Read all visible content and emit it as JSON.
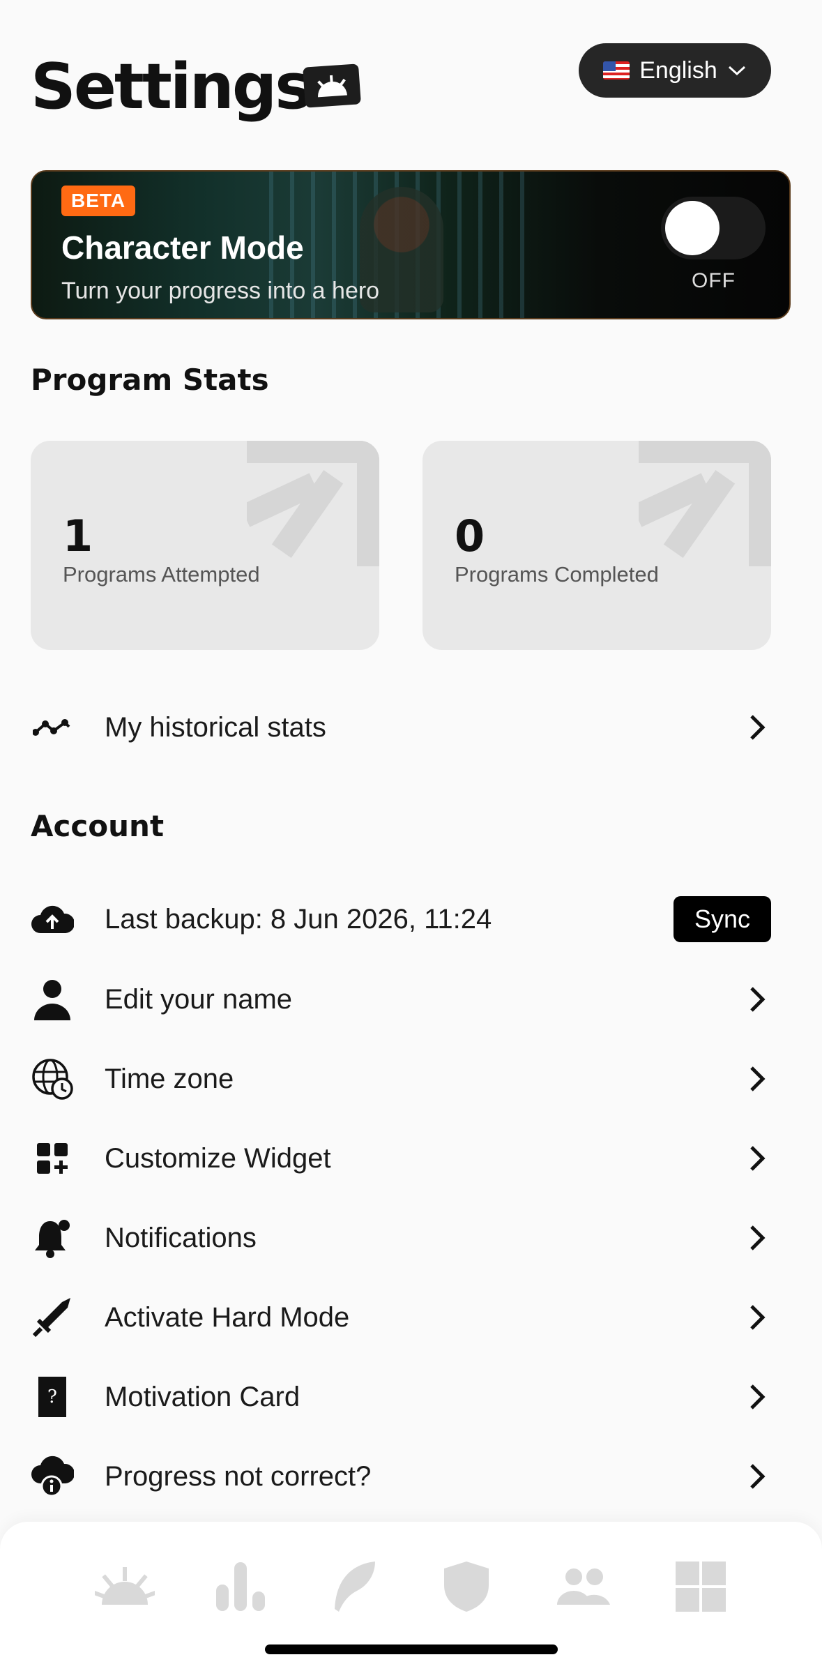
{
  "header": {
    "title": "Settings",
    "language_label": "English"
  },
  "character_mode": {
    "badge": "BETA",
    "title": "Character Mode",
    "subtitle": "Turn your progress into a hero",
    "toggle_label": "OFF",
    "enabled": false
  },
  "program_stats": {
    "heading": "Program Stats",
    "cards": [
      {
        "value": "1",
        "label": "Programs Attempted"
      },
      {
        "value": "0",
        "label": "Programs Completed"
      }
    ],
    "historical_label": "My historical stats"
  },
  "account": {
    "heading": "Account",
    "backup_label": "Last backup: 8 Jun 2026, 11:24",
    "sync_label": "Sync",
    "items": [
      {
        "label": "Edit your name",
        "icon": "person-icon"
      },
      {
        "label": "Time zone",
        "icon": "globe-clock-icon"
      },
      {
        "label": "Customize Widget",
        "icon": "widget-add-icon"
      },
      {
        "label": "Notifications",
        "icon": "bell-icon"
      },
      {
        "label": "Activate Hard Mode",
        "icon": "sword-icon"
      },
      {
        "label": "Motivation Card",
        "icon": "question-card-icon"
      },
      {
        "label": "Progress not correct?",
        "icon": "cloud-info-icon"
      }
    ]
  },
  "tabbar": {
    "tabs": [
      {
        "icon": "sunrise-icon"
      },
      {
        "icon": "bar-chart-icon"
      },
      {
        "icon": "feather-icon"
      },
      {
        "icon": "shield-icon"
      },
      {
        "icon": "people-icon"
      },
      {
        "icon": "grid-icon"
      }
    ]
  },
  "colors": {
    "accent": "#ff6a13",
    "card_bg": "#e8e8e8",
    "tab_icon": "#d9d9d9"
  }
}
